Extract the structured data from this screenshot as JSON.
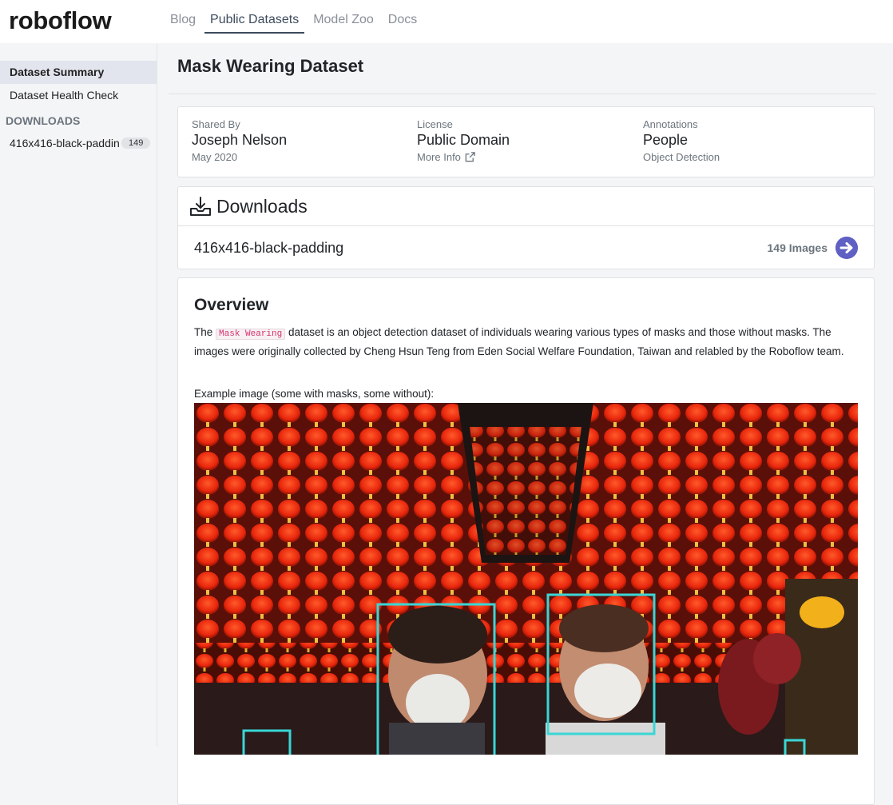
{
  "header": {
    "logo": "roboflow",
    "nav": [
      {
        "label": "Blog",
        "active": false
      },
      {
        "label": "Public Datasets",
        "active": true
      },
      {
        "label": "Model Zoo",
        "active": false
      },
      {
        "label": "Docs",
        "active": false
      }
    ]
  },
  "sidebar": {
    "items": [
      {
        "label": "Dataset Summary",
        "active": true
      },
      {
        "label": "Dataset Health Check",
        "active": false
      }
    ],
    "downloads_heading": "DOWNLOADS",
    "downloads": [
      {
        "label": "416x416-black-padding",
        "count": "149"
      }
    ]
  },
  "page": {
    "title": "Mask Wearing Dataset"
  },
  "info": {
    "shared_by": {
      "label": "Shared By",
      "value": "Joseph Nelson",
      "sub": "May 2020"
    },
    "license": {
      "label": "License",
      "value": "Public Domain",
      "sub": "More Info"
    },
    "annotations": {
      "label": "Annotations",
      "value": "People",
      "sub": "Object Detection"
    }
  },
  "downloads_card": {
    "title": "Downloads",
    "item": {
      "name": "416x416-black-padding",
      "count": "149 Images"
    }
  },
  "overview": {
    "title": "Overview",
    "text_pre": "The ",
    "code": "Mask Wearing",
    "text_post": " dataset is an object detection dataset of individuals wearing various types of masks and those without masks. The images were originally collected by Cheng Hsun Teng from Eden Social Welfare Foundation, Taiwan and relabled by the Roboflow team.",
    "caption": "Example image (some with masks, some without):"
  },
  "colors": {
    "accent": "#5f5fc4",
    "bbox": "#3ad6d6",
    "lantern": "#e8260c"
  },
  "icons": {
    "download": "download-tray-icon",
    "arrow": "arrow-right-circle-icon",
    "external": "external-link-icon"
  }
}
